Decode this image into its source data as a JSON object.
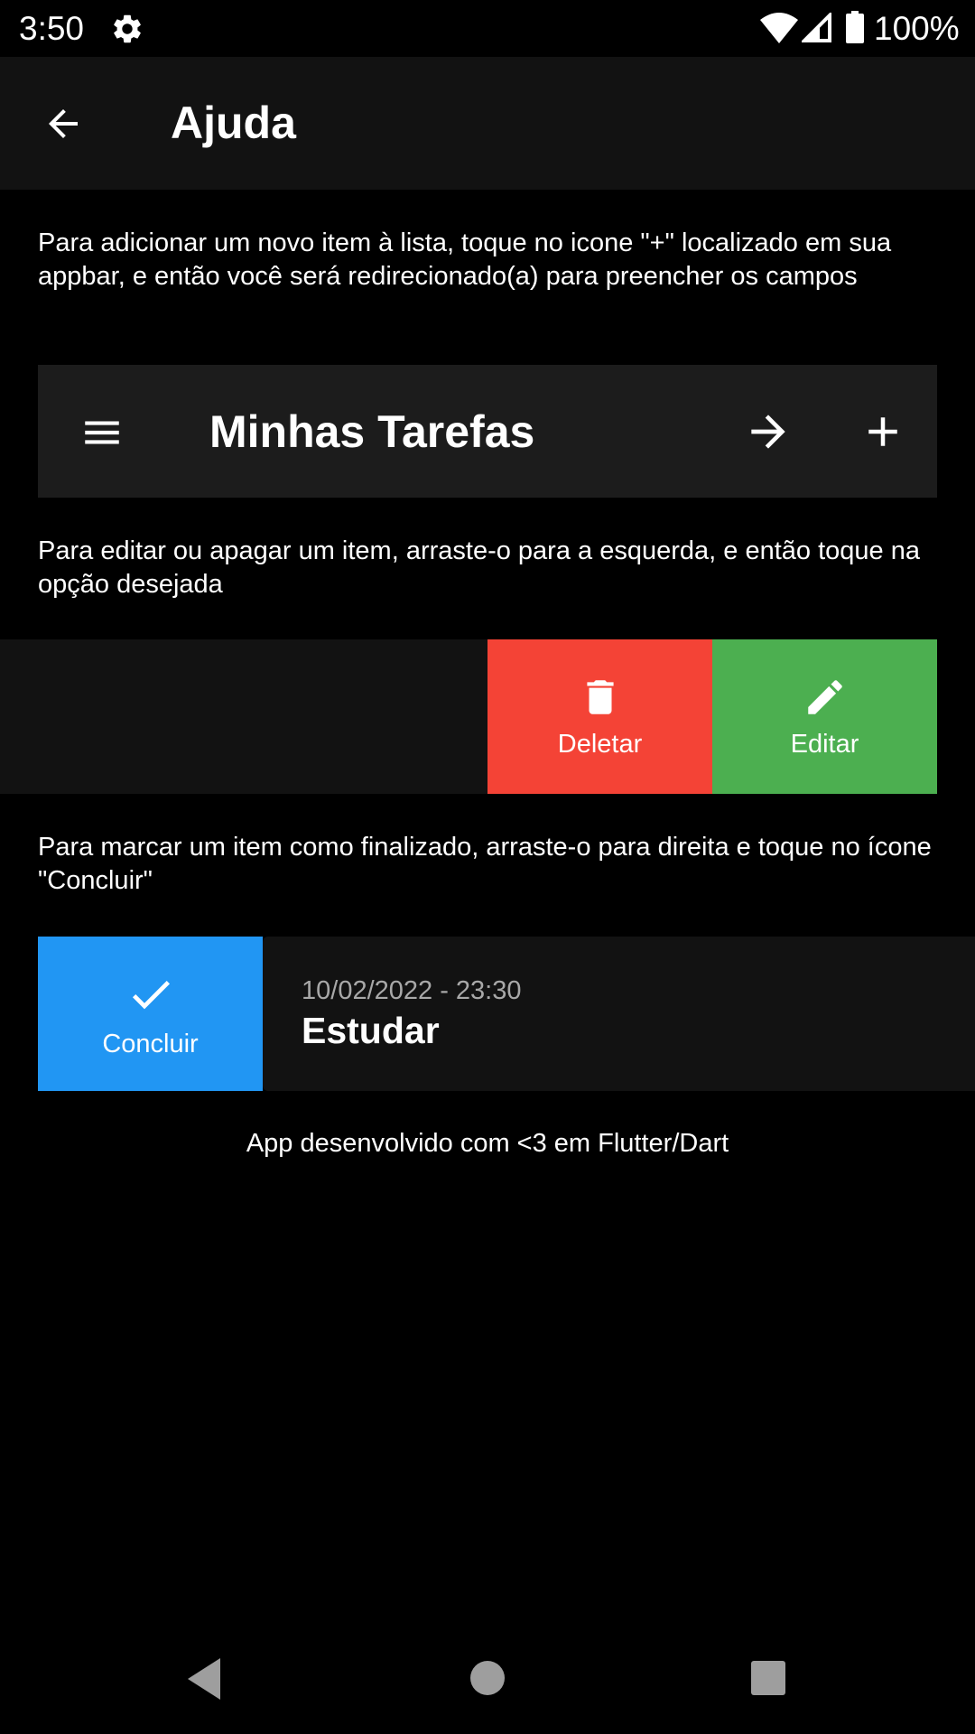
{
  "status_bar": {
    "time": "3:50",
    "battery": "100%",
    "icons": [
      "gear-icon",
      "wifi-icon",
      "signal-icon",
      "battery-icon"
    ]
  },
  "app_bar": {
    "title": "Ajuda",
    "back_icon": "arrow-back-icon"
  },
  "help": {
    "add_text": "Para adicionar um novo item à lista, toque no icone \"+\" localizado em sua appbar, e então você será redirecionado(a) para preencher os campos",
    "edit_text": "Para editar ou apagar um item, arraste-o para a esquerda, e então toque na opção desejada",
    "complete_text": "Para marcar um item como finalizado, arraste-o para direita e toque no ícone \"Concluir\""
  },
  "sample_appbar": {
    "title": "Minhas Tarefas",
    "icons": [
      "menu-icon",
      "arrow-forward-icon",
      "plus-icon"
    ]
  },
  "actions": {
    "delete_label": "Deletar",
    "edit_label": "Editar",
    "complete_label": "Concluir"
  },
  "task": {
    "date": "10/02/2022 - 23:30",
    "title": "Estudar"
  },
  "footer": {
    "text": "App desenvolvido com <3 em Flutter/Dart"
  },
  "colors": {
    "background": "#000000",
    "surface": "#121212",
    "delete": "#f44336",
    "edit": "#4caf50",
    "complete": "#2196f3"
  },
  "nav_bar": {
    "icons": [
      "nav-back-icon",
      "nav-home-icon",
      "nav-recents-icon"
    ]
  }
}
